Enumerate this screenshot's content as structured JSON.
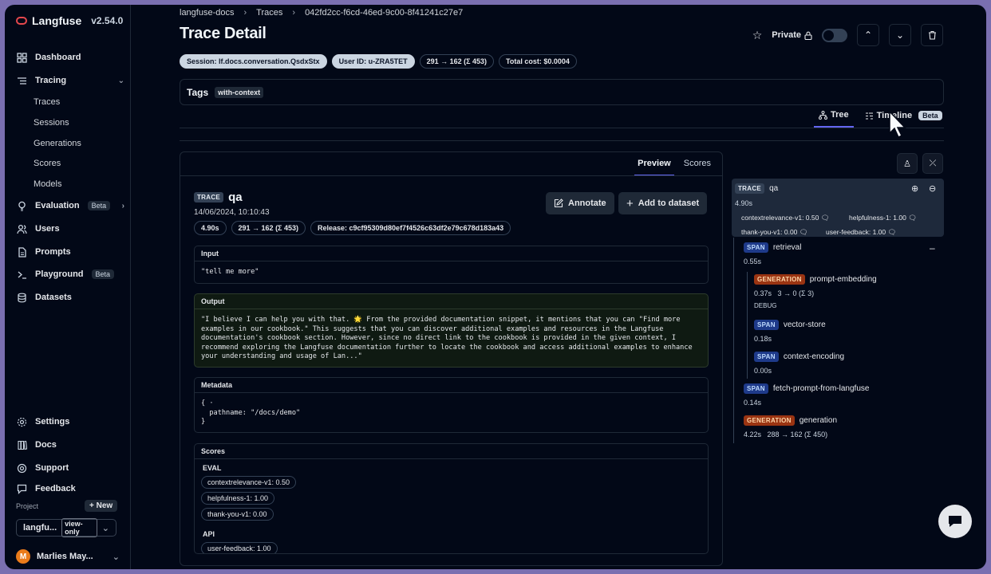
{
  "app": {
    "name": "Langfuse",
    "version": "v2.54.0"
  },
  "sidebar": {
    "items": [
      {
        "label": "Dashboard",
        "icon": "grid-icon"
      },
      {
        "label": "Tracing",
        "icon": "list-icon"
      },
      {
        "label": "Evaluation",
        "icon": "lightbulb-icon",
        "badge": "Beta"
      },
      {
        "label": "Users",
        "icon": "users-icon"
      },
      {
        "label": "Prompts",
        "icon": "file-icon"
      },
      {
        "label": "Playground",
        "icon": "terminal-icon",
        "badge": "Beta"
      },
      {
        "label": "Datasets",
        "icon": "database-icon"
      }
    ],
    "tracing_sub": [
      "Traces",
      "Sessions",
      "Generations",
      "Scores",
      "Models"
    ],
    "bottom": [
      {
        "label": "Settings",
        "icon": "gear-icon"
      },
      {
        "label": "Docs",
        "icon": "book-icon"
      },
      {
        "label": "Support",
        "icon": "lifebuoy-icon"
      },
      {
        "label": "Feedback",
        "icon": "message-icon"
      }
    ],
    "project_label": "Project",
    "new_label": "New",
    "project_name": "langfu...",
    "project_role": "view-only",
    "user_initial": "M",
    "user_name": "Marlies May..."
  },
  "breadcrumb": [
    "langfuse-docs",
    "Traces",
    "042fd2cc-f6cd-46ed-9c00-8f41241c27e7"
  ],
  "page_title": "Trace Detail",
  "header": {
    "private_label": "Private"
  },
  "badges": [
    {
      "text": "Session: lf.docs.conversation.QsdxStx",
      "style": "light"
    },
    {
      "text": "User ID: u-ZRA5TET",
      "style": "light"
    },
    {
      "text": "291 → 162 (Σ 453)",
      "style": "dark"
    },
    {
      "text": "Total cost: $0.0004",
      "style": "dark"
    }
  ],
  "tags": {
    "label": "Tags",
    "values": [
      "with-context"
    ]
  },
  "view_tabs": {
    "tree": "Tree",
    "timeline": "Timeline",
    "beta": "Beta"
  },
  "panel": {
    "tabs": [
      "Preview",
      "Scores"
    ],
    "type": "TRACE",
    "name": "qa",
    "date": "14/06/2024, 10:10:43",
    "badges": [
      "4.90s",
      "291 → 162 (Σ 453)",
      "Release: c9cf95309d80ef7f4526c63df2e79c678d183a43"
    ],
    "annotate": "Annotate",
    "add_dataset": "Add to dataset",
    "input_label": "Input",
    "input": "\"tell me more\"",
    "output_label": "Output",
    "output": "\"I believe I can help you with that. 🌟 From the provided documentation snippet, it mentions that you can \"Find more\nexamples in our cookbook.\" This suggests that you can discover additional examples and resources in the Langfuse\ndocumentation's cookbook section. However, since no direct link to the cookbook is provided in the given context, I\nrecommend exploring the Langfuse documentation further to locate the cookbook and access additional examples to enhance\nyour understanding and usage of Lan...\"",
    "metadata_label": "Metadata",
    "metadata": "{ ·\n  pathname: \"/docs/demo\"\n}",
    "scores_label": "Scores",
    "scores": [
      {
        "category": "EVAL",
        "items": [
          "contextrelevance-v1: 0.50",
          "helpfulness-1: 1.00",
          "thank-you-v1: 0.00"
        ]
      },
      {
        "category": "API",
        "items": [
          "user-feedback: 1.00"
        ]
      }
    ]
  },
  "tree": {
    "trace": {
      "type": "TRACE",
      "name": "qa",
      "latency": "4.90s",
      "scores": [
        "contextrelevance-v1: 0.50",
        "helpfulness-1: 1.00",
        "thank-you-v1: 0.00",
        "user-feedback: 1.00"
      ]
    },
    "nodes": [
      {
        "type": "SPAN",
        "name": "retrieval",
        "meta": "0.55s"
      },
      {
        "type": "GENERATION",
        "name": "prompt-embedding",
        "meta": "0.37s   3 → 0 (Σ 3)",
        "extra": "DEBUG"
      },
      {
        "type": "SPAN",
        "name": "vector-store",
        "meta": "0.18s"
      },
      {
        "type": "SPAN",
        "name": "context-encoding",
        "meta": "0.00s"
      },
      {
        "type": "SPAN",
        "name": "fetch-prompt-from-langfuse",
        "meta": "0.14s"
      },
      {
        "type": "GENERATION",
        "name": "generation",
        "meta": "4.22s   288 → 162 (Σ 450)"
      }
    ]
  },
  "colors": {
    "accent": "#6366f1",
    "span": "#1e3a8a",
    "generation": "#9a3412",
    "background": "#020817"
  }
}
